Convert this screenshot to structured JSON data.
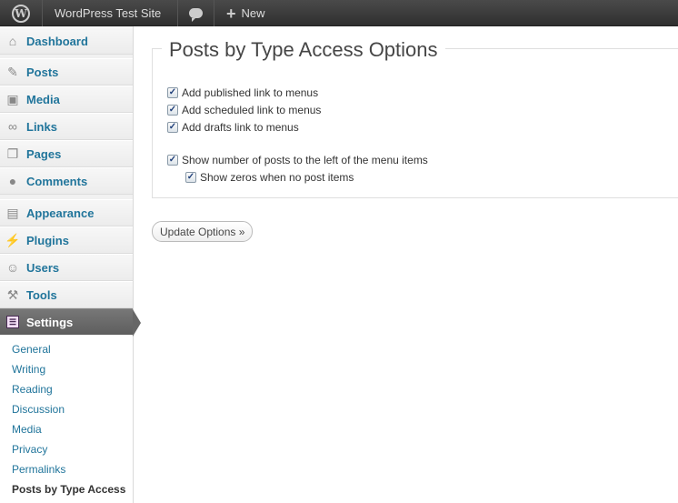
{
  "adminbar": {
    "logo_icon": "wordpress-logo-icon",
    "site_name": "WordPress Test Site",
    "comments_icon": "comment-bubble-icon",
    "new_label": "New",
    "new_icon": "plus-icon"
  },
  "sidebar": {
    "items": [
      {
        "label": "Dashboard",
        "icon": "dashboard-icon"
      },
      {
        "label": "Posts",
        "icon": "pushpin-icon"
      },
      {
        "label": "Media",
        "icon": "media-icon"
      },
      {
        "label": "Links",
        "icon": "link-icon"
      },
      {
        "label": "Pages",
        "icon": "pages-icon"
      },
      {
        "label": "Comments",
        "icon": "comments-icon"
      },
      {
        "label": "Appearance",
        "icon": "appearance-icon"
      },
      {
        "label": "Plugins",
        "icon": "plugin-icon"
      },
      {
        "label": "Users",
        "icon": "users-icon"
      },
      {
        "label": "Tools",
        "icon": "tools-icon"
      },
      {
        "label": "Settings",
        "icon": "settings-icon"
      }
    ],
    "submenu": [
      "General",
      "Writing",
      "Reading",
      "Discussion",
      "Media",
      "Privacy",
      "Permalinks",
      "Posts by Type Access"
    ]
  },
  "main": {
    "title": "Posts by Type Access Options",
    "options": [
      {
        "label": "Add published link to menus",
        "checked": true
      },
      {
        "label": "Add scheduled link to menus",
        "checked": true
      },
      {
        "label": "Add drafts link to menus",
        "checked": true
      },
      {
        "label": "Show number of posts to the left of the menu items",
        "checked": true
      },
      {
        "label": "Show zeros when no post items",
        "checked": true
      }
    ],
    "button_label": "Update Options »"
  },
  "colors": {
    "link": "#21759b",
    "adminbar": "#464646",
    "current_menu": "#6d6d6d"
  }
}
